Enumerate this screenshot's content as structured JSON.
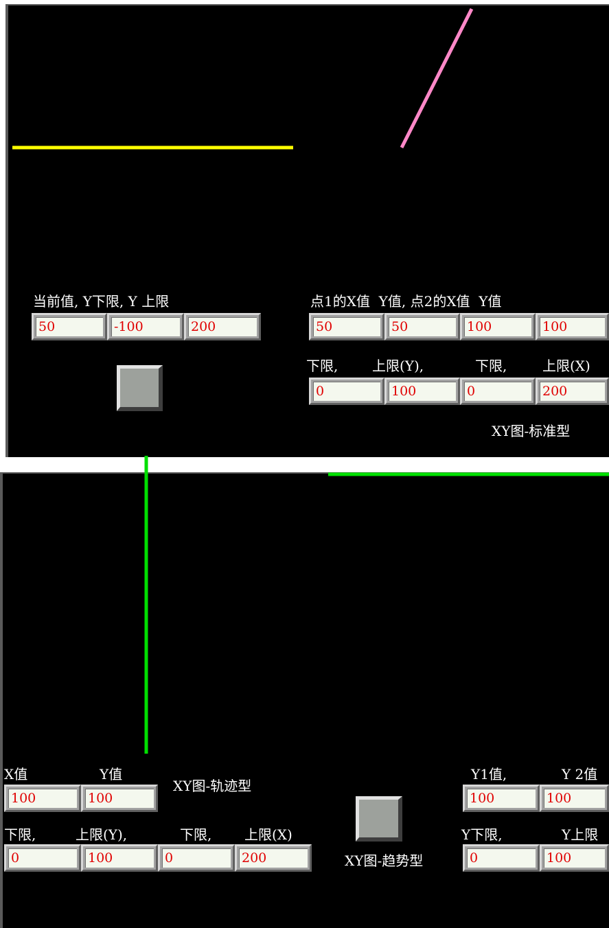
{
  "top": {
    "labels": {
      "current_header": "当前值, Y下限, Y 上限",
      "points_header": "点1的X值  Y值, 点2的X值  Y值",
      "lower_y": "下限,",
      "upper_y": "上限(Y),",
      "lower_x": "下限,",
      "upper_x": "上限(X)",
      "chart_type": "XY图-标准型"
    },
    "fields": {
      "current_value": "50",
      "y_lower": "-100",
      "y_upper": "200",
      "p1_x": "50",
      "p1_y": "50",
      "p2_x": "100",
      "p2_y": "100",
      "lower_y": "0",
      "upper_y": "100",
      "lower_x": "0",
      "upper_x": "200"
    },
    "line_colors": {
      "current": "#ffff00",
      "xy": "#ff88c8"
    }
  },
  "bottom": {
    "labels": {
      "x_value": "X值",
      "y_value": "Y值",
      "track_type": "XY图-轨迹型",
      "lower_y": "下限,",
      "upper_y": "上限(Y),",
      "lower_x": "下限,",
      "upper_x": "上限(X)",
      "trend_type": "XY图-趋势型",
      "y1_value": "Y1值,",
      "y2_value": "Y 2值",
      "trend_y_lower": "Y下限,",
      "trend_y_upper": "Y上限"
    },
    "fields": {
      "x_value": "100",
      "y_value": "100",
      "lower_y": "0",
      "upper_y": "100",
      "lower_x": "0",
      "upper_x": "200",
      "y1_value": "100",
      "y2_value": "100",
      "trend_y_lower": "0",
      "trend_y_upper": "100"
    },
    "line_colors": {
      "track": "#00e000",
      "trend": "#00e000"
    }
  }
}
